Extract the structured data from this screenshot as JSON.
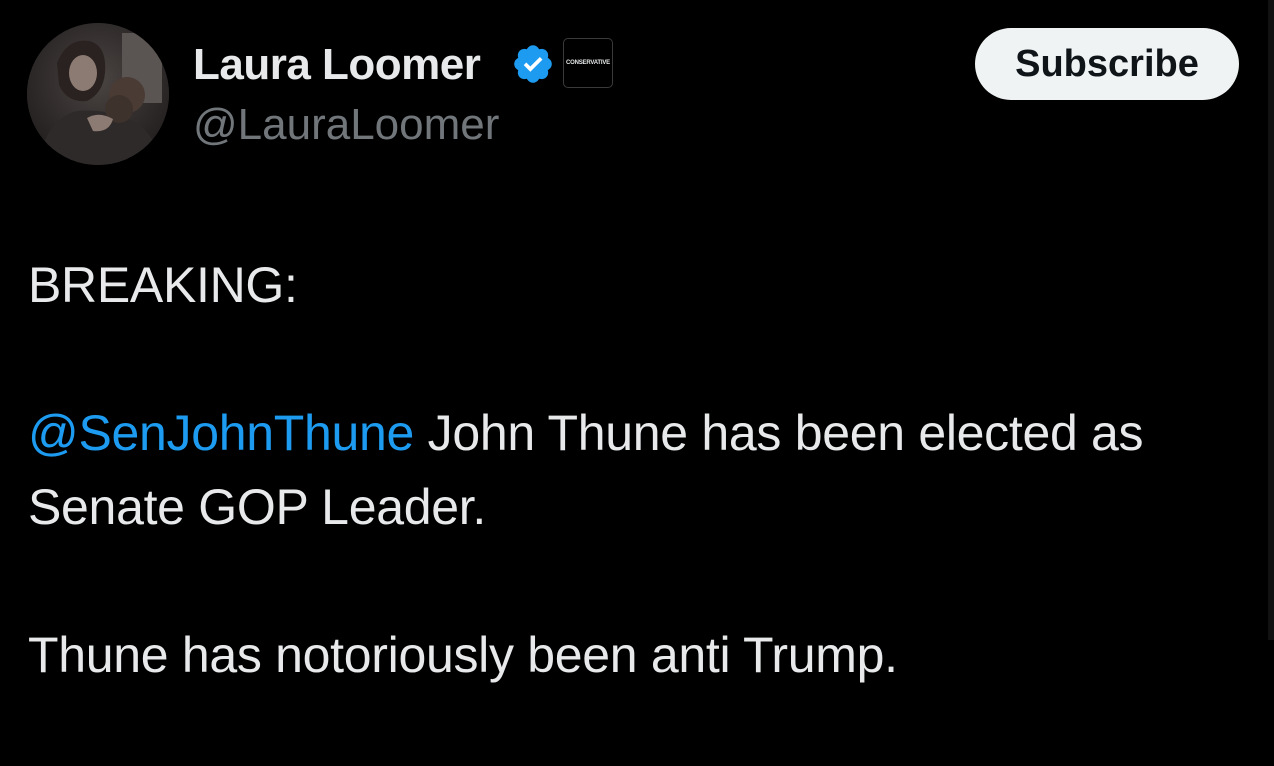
{
  "author": {
    "name": "Laura Loomer",
    "handle": "@LauraLoomer",
    "avatar_icon": "profile-photo",
    "verified_icon": "verified-checkmark-icon",
    "affiliation_badge_text": "CONSERVATIVE"
  },
  "actions": {
    "subscribe_label": "Subscribe"
  },
  "tweet": {
    "line1": "BREAKING:",
    "mention": "@SenJohnThune",
    "line2_rest": " John Thune has been elected as Senate GOP Leader.",
    "line3": "Thune has notoriously been anti Trump."
  },
  "colors": {
    "background": "#000000",
    "text": "#e7e9ea",
    "secondary_text": "#71767b",
    "link": "#1d9bf0",
    "verified": "#1d9bf0",
    "button_bg": "#eff3f4",
    "button_text": "#0f1419"
  }
}
